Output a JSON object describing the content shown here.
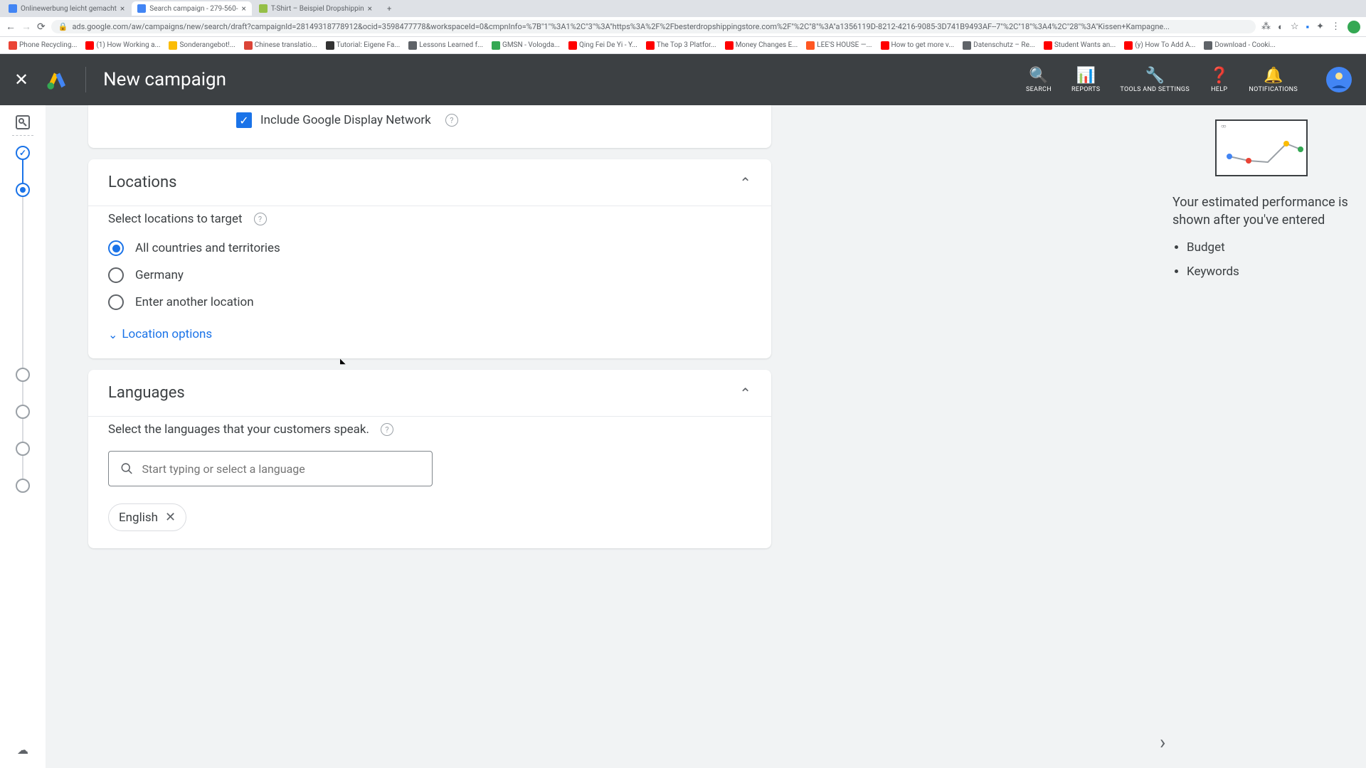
{
  "browser": {
    "tabs": [
      {
        "title": "Onlinewerbung leicht gemacht",
        "active": false
      },
      {
        "title": "Search campaign - 279-560-",
        "active": true
      },
      {
        "title": "T-Shirt – Beispiel Dropshippin",
        "active": false
      }
    ],
    "url": "ads.google.com/aw/campaigns/new/search/draft?campaignId=28149318778912&ocid=3598477778&workspaceId=0&cmpnInfo=%7B\"1\"%3A1%2C\"3\"%3A\"https%3A%2F%2Fbesterdropshippingstore.com%2F\"%2C\"8\"%3A\"a1356119D-8212-4216-9085-3D741B9493AF--7\"%2C\"18\"%3A4%2C\"28\"%3A\"Kissen+Kampagne...",
    "bookmarks": [
      "Phone Recycling...",
      "(1) How Working a...",
      "Sonderangebot!...",
      "Chinese translatio...",
      "Tutorial: Eigene Fa...",
      "Lessons Learned f...",
      "GMSN - Vologda...",
      "Qing Fei De Yi - Y...",
      "The Top 3 Platfor...",
      "Money Changes E...",
      "LEE'S HOUSE —...",
      "How to get more v...",
      "Datenschutz – Re...",
      "Student Wants an...",
      "(y) How To Add A...",
      "Download - Cooki..."
    ]
  },
  "header": {
    "title": "New campaign",
    "actions": {
      "search": "SEARCH",
      "reports": "REPORTS",
      "tools": "TOOLS AND SETTINGS",
      "help": "HELP",
      "notifications": "NOTIFICATIONS"
    }
  },
  "network": {
    "checkbox_label": "Include Google Display Network"
  },
  "locations": {
    "title": "Locations",
    "subhead": "Select locations to target",
    "options": [
      "All countries and territories",
      "Germany",
      "Enter another location"
    ],
    "selected": 0,
    "expander": "Location options"
  },
  "languages": {
    "title": "Languages",
    "subhead": "Select the languages that your customers speak.",
    "placeholder": "Start typing or select a language",
    "chips": [
      "English"
    ]
  },
  "estimate": {
    "text": "Your estimated performance is shown after you've entered",
    "items": [
      "Budget",
      "Keywords"
    ]
  }
}
